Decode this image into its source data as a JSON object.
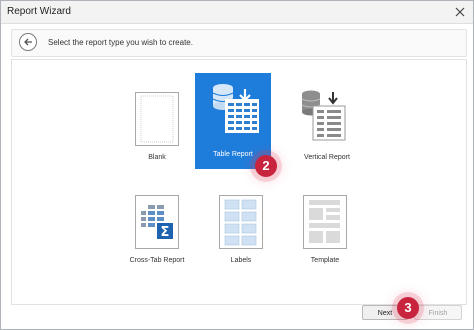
{
  "window": {
    "title": "Report Wizard"
  },
  "header": {
    "prompt": "Select the report type you wish to create."
  },
  "report_types": [
    {
      "label": "Blank",
      "icon": "blank-report-icon",
      "selected": false
    },
    {
      "label": "Table Report",
      "icon": "table-report-icon",
      "selected": true
    },
    {
      "label": "Vertical Report",
      "icon": "vertical-report-icon",
      "selected": false
    },
    {
      "label": "Cross-Tab Report",
      "icon": "cross-tab-report-icon",
      "selected": false
    },
    {
      "label": "Labels",
      "icon": "labels-icon",
      "selected": false
    },
    {
      "label": "Template",
      "icon": "template-icon",
      "selected": false
    }
  ],
  "footer": {
    "next_label": "Next",
    "finish_label": "Finish",
    "finish_enabled": false
  },
  "steps": {
    "select_step": "2",
    "next_step": "3"
  },
  "colors": {
    "accent": "#1e7ddb",
    "step_badge": "#c8243e",
    "tile_border": "#a8a8a8",
    "cell_blue": "#cfe1f3"
  }
}
